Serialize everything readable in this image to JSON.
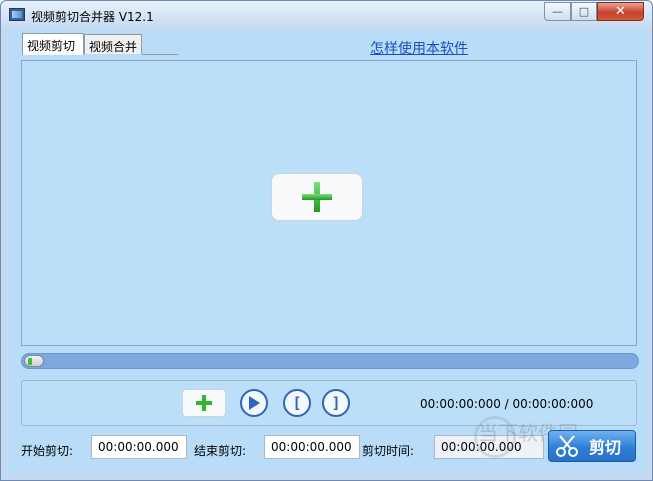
{
  "window": {
    "title": "视频剪切合并器 V12.1",
    "minimize": "—",
    "maximize": "□",
    "close": "✕"
  },
  "tabs": [
    {
      "label": "视频剪切",
      "active": true
    },
    {
      "label": "视频合并",
      "active": false
    }
  ],
  "help_link": "怎样使用本软件",
  "preview": {
    "add_icon": "plus-icon"
  },
  "progress": {
    "value": 0
  },
  "controls": {
    "add_icon": "plus-icon",
    "play_icon": "play-icon",
    "mark_in": "[",
    "mark_out": "]",
    "time_readout": "00:00:00:000 / 00:00:00:000"
  },
  "fields": {
    "start_label": "开始剪切:",
    "start_value": "00:00:00.000",
    "end_label": "结束剪切:",
    "end_value": "00:00:00.000",
    "duration_label": "剪切时间:",
    "duration_value": "00:00:00.000"
  },
  "cut_button": {
    "label": "剪切",
    "icon": "scissors-icon"
  },
  "watermark": "当下软件园",
  "colors": {
    "accent": "#2e7fd8",
    "plus_green": "#2fb52f",
    "link": "#1a4fbf"
  }
}
